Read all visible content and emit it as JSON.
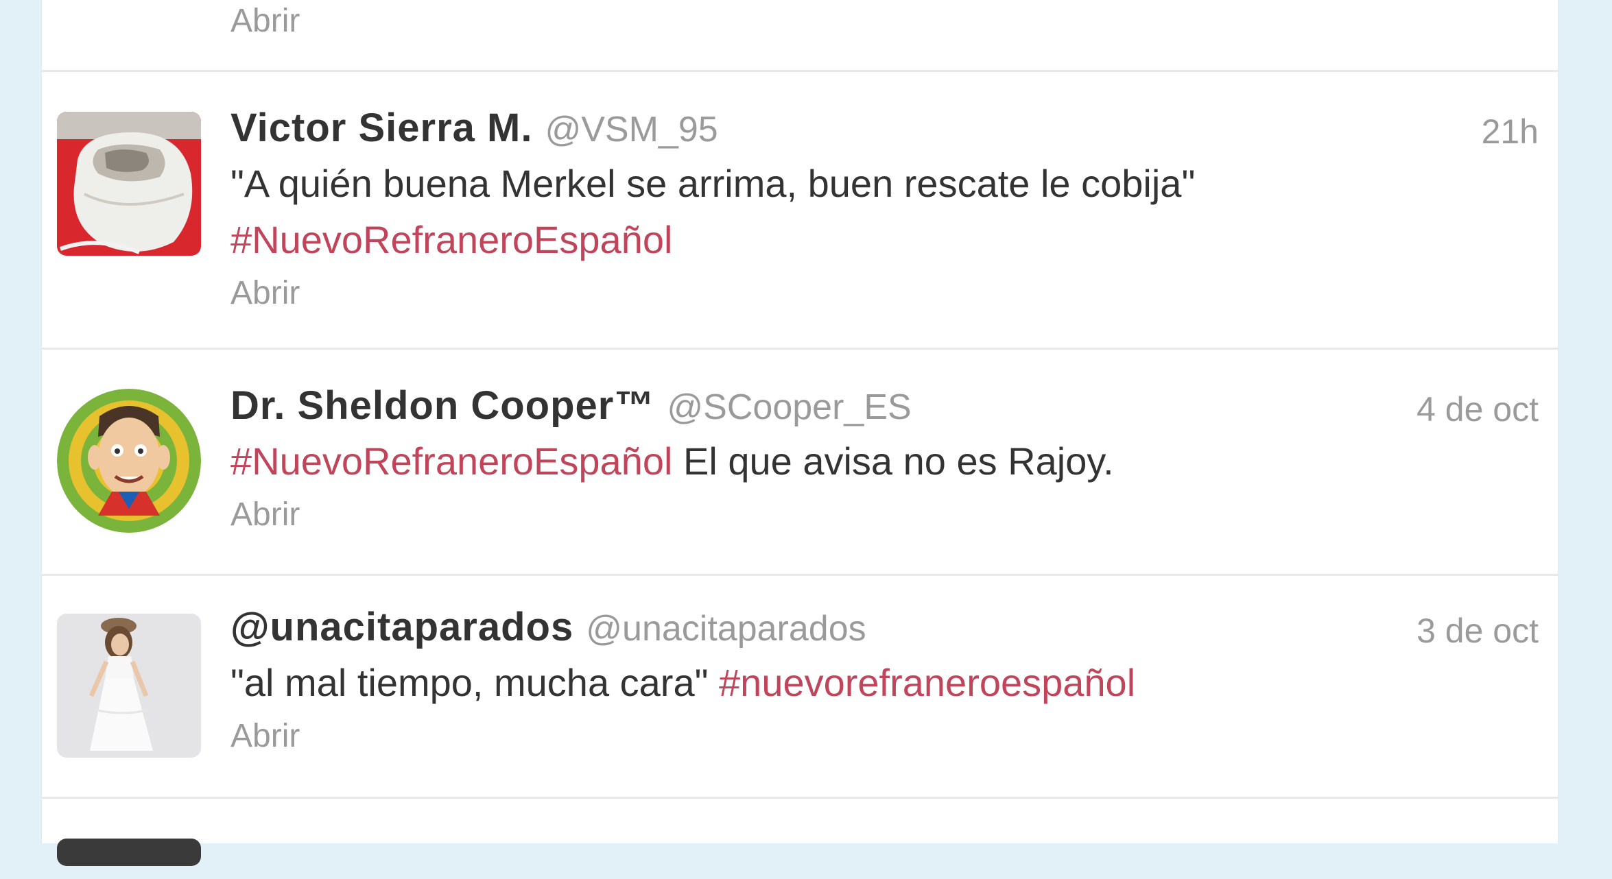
{
  "timeline": {
    "top_partial": {
      "open_label": "Abrir"
    },
    "tweets": [
      {
        "name": "Victor Sierra M.",
        "handle": "@VSM_95",
        "time": "21h",
        "text_line1": "\"A quién buena Merkel se arrima, buen rescate le cobija\"",
        "hashtag": "#NuevoRefraneroEspañol",
        "open_label": "Abrir",
        "avatar_icon": "computer-mouse-photo"
      },
      {
        "name": "Dr. Sheldon Cooper™",
        "handle": "@SCooper_ES",
        "time": "4 de oct",
        "hashtag": "#NuevoRefraneroEspañol",
        "text_after": " El que avisa no es Rajoy.",
        "open_label": "Abrir",
        "avatar_icon": "sheldon-caricature"
      },
      {
        "name": "@unacitaparados",
        "handle": "@unacitaparados",
        "time": "3 de oct",
        "text_before": "\"al mal tiempo, mucha cara\" ",
        "hashtag": "#nuevorefraneroespañol",
        "open_label": "Abrir",
        "avatar_icon": "woman-in-white-dress-photo"
      }
    ]
  },
  "colors": {
    "page_background": "#e2f1f7",
    "hashtag": "#c0455a",
    "muted": "#9a9a9a",
    "text": "#333333"
  }
}
